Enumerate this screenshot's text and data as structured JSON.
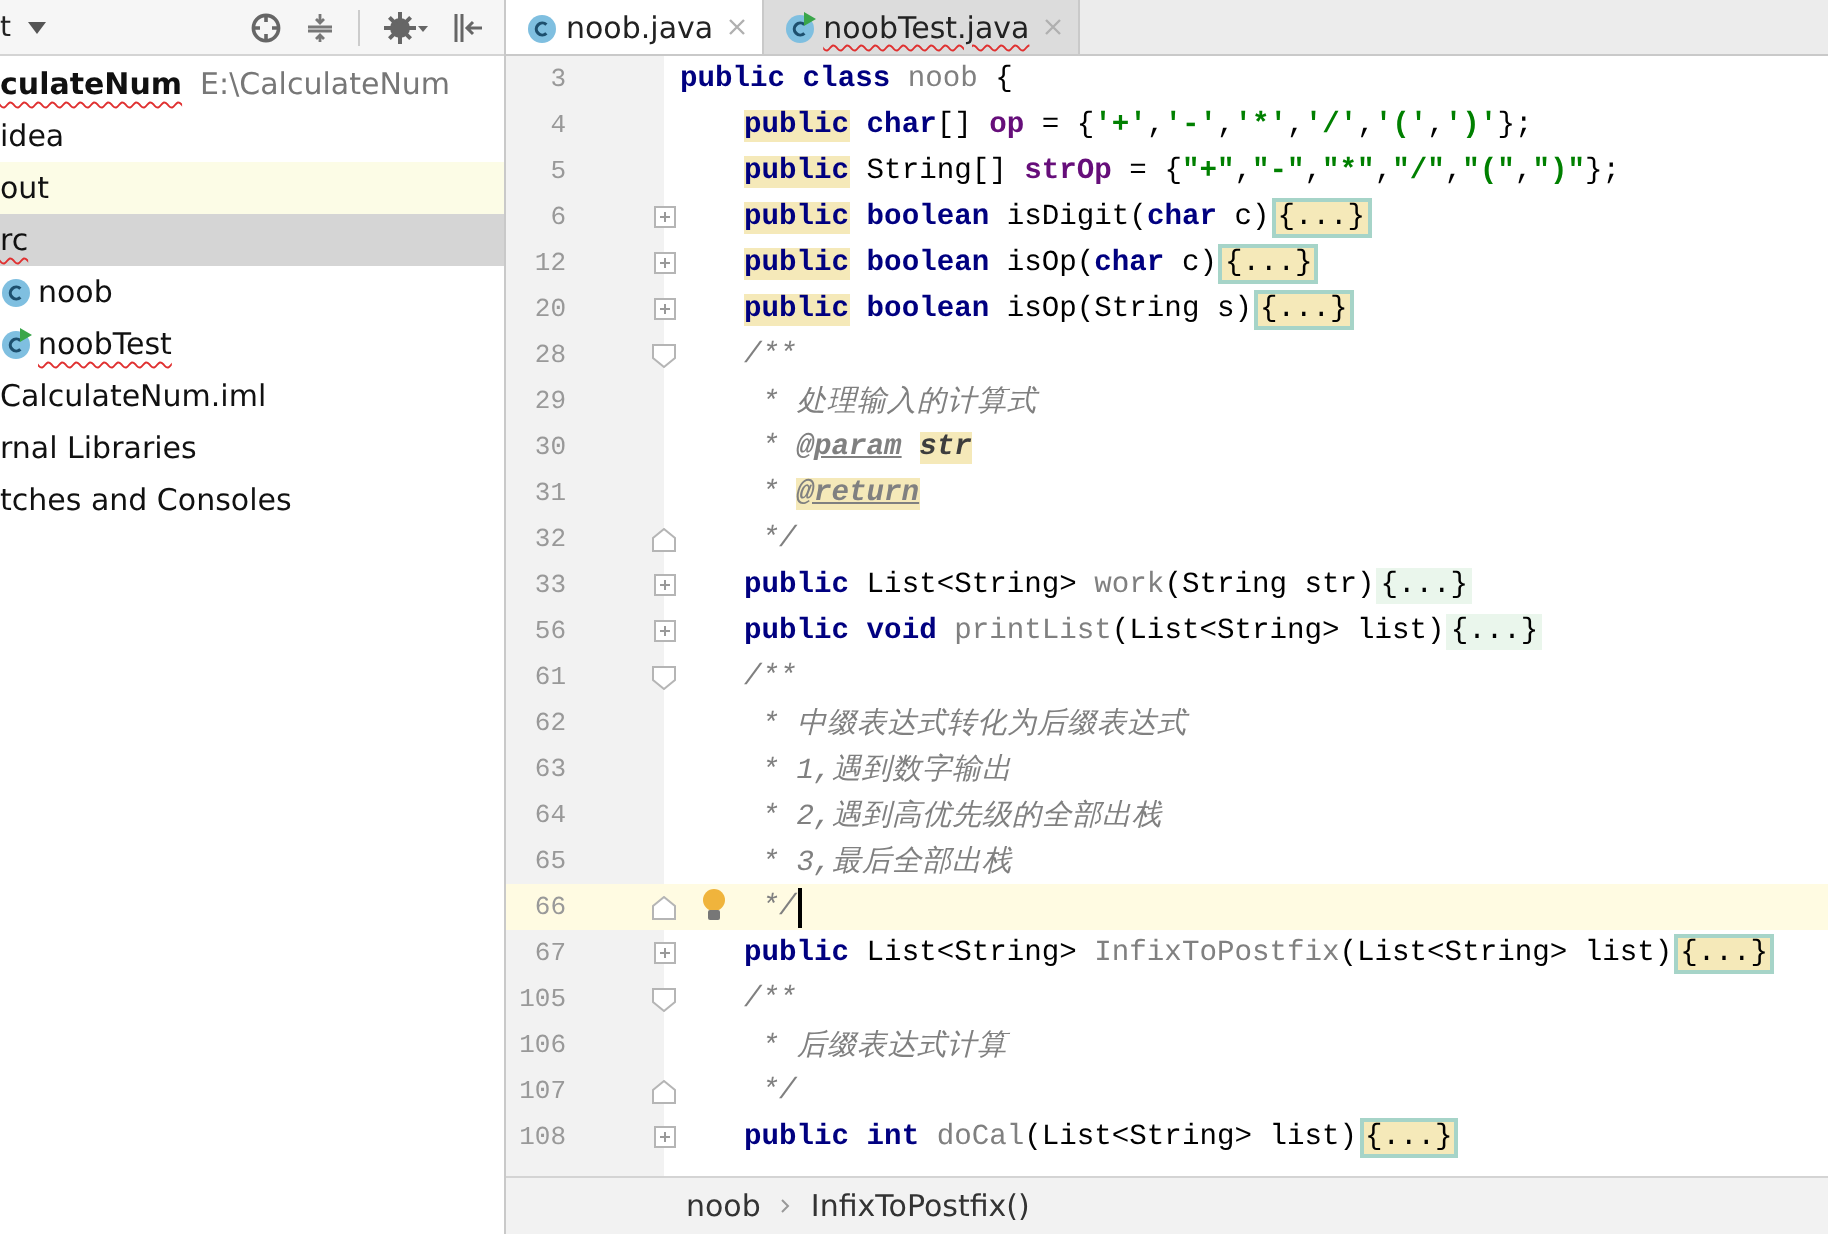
{
  "project_panel": {
    "view_selector": "t",
    "tree": [
      {
        "label": "culateNum",
        "note": "E:\\CalculateNum",
        "kind": "module",
        "typo": true,
        "selected": false,
        "highlighted": false,
        "children": [
          {
            "label": "idea",
            "typo": false,
            "selected": false,
            "highlighted": false
          },
          {
            "label": "out",
            "typo": false,
            "selected": false,
            "highlighted": true
          },
          {
            "label": "rc",
            "typo": true,
            "selected": true,
            "highlighted": false,
            "children": [
              {
                "label": "noob",
                "kind": "class",
                "typo": false,
                "selected": false,
                "highlighted": false
              },
              {
                "label": "noobTest",
                "kind": "test_class",
                "typo": true,
                "selected": false,
                "highlighted": false
              }
            ]
          },
          {
            "label": "CalculateNum.iml",
            "typo": false,
            "selected": false,
            "highlighted": false
          }
        ]
      },
      {
        "label": "rnal Libraries",
        "typo": false,
        "selected": false,
        "highlighted": false
      },
      {
        "label": "tches and Consoles",
        "typo": false,
        "selected": false,
        "highlighted": false
      }
    ]
  },
  "tabs": [
    {
      "label": "noob.java",
      "kind": "class",
      "typo": false,
      "selected": true
    },
    {
      "label": "noobTest.java",
      "kind": "test_class",
      "typo": true,
      "selected": false
    }
  ],
  "editor": {
    "lines": [
      {
        "number": "3",
        "indented": false,
        "current": false,
        "tokens": [
          {
            "text": "public class ",
            "kind": "kw"
          },
          {
            "text": "noob",
            "kind": "unused"
          },
          {
            "text": " {",
            "kind": "plain"
          }
        ]
      },
      {
        "number": "4",
        "indented": true,
        "current": false,
        "tokens": [
          {
            "text": "public",
            "kind": "kw_marked"
          },
          {
            "text": " char",
            "kind": "kw"
          },
          {
            "text": "[] ",
            "kind": "plain"
          },
          {
            "text": "op",
            "kind": "field"
          },
          {
            "text": " = {",
            "kind": "plain"
          },
          {
            "text": "'+'",
            "kind": "str"
          },
          {
            "text": ",",
            "kind": "plain"
          },
          {
            "text": "'-'",
            "kind": "str"
          },
          {
            "text": ",",
            "kind": "plain"
          },
          {
            "text": "'*'",
            "kind": "str"
          },
          {
            "text": ",",
            "kind": "plain"
          },
          {
            "text": "'/'",
            "kind": "str"
          },
          {
            "text": ",",
            "kind": "plain"
          },
          {
            "text": "'('",
            "kind": "str"
          },
          {
            "text": ",",
            "kind": "plain"
          },
          {
            "text": "')'",
            "kind": "str"
          },
          {
            "text": "};",
            "kind": "plain"
          }
        ]
      },
      {
        "number": "5",
        "indented": true,
        "current": false,
        "tokens": [
          {
            "text": "public",
            "kind": "kw_marked"
          },
          {
            "text": " String[] ",
            "kind": "plain"
          },
          {
            "text": "strOp",
            "kind": "field"
          },
          {
            "text": " = {",
            "kind": "plain"
          },
          {
            "text": "\"+\"",
            "kind": "str"
          },
          {
            "text": ",",
            "kind": "plain"
          },
          {
            "text": "\"-\"",
            "kind": "str"
          },
          {
            "text": ",",
            "kind": "plain"
          },
          {
            "text": "\"*\"",
            "kind": "str"
          },
          {
            "text": ",",
            "kind": "plain"
          },
          {
            "text": "\"/\"",
            "kind": "str"
          },
          {
            "text": ",",
            "kind": "plain"
          },
          {
            "text": "\"(\"",
            "kind": "str"
          },
          {
            "text": ",",
            "kind": "plain"
          },
          {
            "text": "\")\"",
            "kind": "str"
          },
          {
            "text": "};",
            "kind": "plain"
          }
        ]
      },
      {
        "number": "6",
        "fold": {
          "kind": "plus"
        },
        "indented": true,
        "current": false,
        "folded": {
          "text": "{...}",
          "marked": true
        },
        "tokens": [
          {
            "text": "public",
            "kind": "kw_marked"
          },
          {
            "text": " boolean",
            "kind": "kw"
          },
          {
            "text": " isDigit(",
            "kind": "plain"
          },
          {
            "text": "char",
            "kind": "kw"
          },
          {
            "text": " c)",
            "kind": "plain"
          }
        ]
      },
      {
        "number": "12",
        "fold": {
          "kind": "plus"
        },
        "indented": true,
        "current": false,
        "folded": {
          "text": "{...}",
          "marked": true
        },
        "tokens": [
          {
            "text": "public",
            "kind": "kw_marked"
          },
          {
            "text": " boolean",
            "kind": "kw"
          },
          {
            "text": " isOp(",
            "kind": "plain"
          },
          {
            "text": "char",
            "kind": "kw"
          },
          {
            "text": " c)",
            "kind": "plain"
          }
        ]
      },
      {
        "number": "20",
        "fold": {
          "kind": "plus"
        },
        "indented": true,
        "current": false,
        "folded": {
          "text": "{...}",
          "marked": true
        },
        "tokens": [
          {
            "text": "public",
            "kind": "kw_marked"
          },
          {
            "text": " boolean",
            "kind": "kw"
          },
          {
            "text": " isOp(String s)",
            "kind": "plain"
          }
        ]
      },
      {
        "number": "28",
        "fold": {
          "kind": "start"
        },
        "indented": true,
        "current": false,
        "tokens": [
          {
            "text": "/**",
            "kind": "comment"
          }
        ]
      },
      {
        "number": "29",
        "indented": true,
        "current": false,
        "tokens": [
          {
            "text": "* 处理输入的计算式",
            "kind": "doc_body"
          }
        ]
      },
      {
        "number": "30",
        "indented": true,
        "current": false,
        "tokens": [
          {
            "text": "* ",
            "kind": "doc_body"
          },
          {
            "text": "@param",
            "kind": "doctag"
          },
          {
            "text": "str",
            "kind": "param_marked"
          }
        ]
      },
      {
        "number": "31",
        "indented": true,
        "current": false,
        "tokens": [
          {
            "text": "* ",
            "kind": "doc_body"
          },
          {
            "text": "@return",
            "kind": "doctag_marked"
          }
        ]
      },
      {
        "number": "32",
        "fold": {
          "kind": "end"
        },
        "indented": true,
        "current": false,
        "tokens": [
          {
            "text": "*/",
            "kind": "doc_body"
          }
        ]
      },
      {
        "number": "33",
        "fold": {
          "kind": "plus"
        },
        "indented": true,
        "current": false,
        "folded": {
          "text": "{...}",
          "marked": false
        },
        "tokens": [
          {
            "text": "public",
            "kind": "kw"
          },
          {
            "text": " List<String> ",
            "kind": "plain"
          },
          {
            "text": "work",
            "kind": "unused"
          },
          {
            "text": "(String str)",
            "kind": "plain"
          }
        ]
      },
      {
        "number": "56",
        "fold": {
          "kind": "plus"
        },
        "indented": true,
        "current": false,
        "folded": {
          "text": "{...}",
          "marked": false
        },
        "tokens": [
          {
            "text": "public void",
            "kind": "kw"
          },
          {
            "text": " printList",
            "kind": "unused"
          },
          {
            "text": "(List<String> list)",
            "kind": "plain"
          }
        ]
      },
      {
        "number": "61",
        "fold": {
          "kind": "start"
        },
        "indented": true,
        "current": false,
        "tokens": [
          {
            "text": "/**",
            "kind": "comment"
          }
        ]
      },
      {
        "number": "62",
        "indented": true,
        "current": false,
        "tokens": [
          {
            "text": "* 中缀表达式转化为后缀表达式",
            "kind": "doc_body"
          }
        ]
      },
      {
        "number": "63",
        "indented": true,
        "current": false,
        "tokens": [
          {
            "text": "* 1,遇到数字输出",
            "kind": "doc_body"
          }
        ]
      },
      {
        "number": "64",
        "indented": true,
        "current": false,
        "tokens": [
          {
            "text": "* 2,遇到高优先级的全部出栈",
            "kind": "doc_body"
          }
        ]
      },
      {
        "number": "65",
        "indented": true,
        "current": false,
        "tokens": [
          {
            "text": "* 3,最后全部出栈",
            "kind": "doc_body"
          }
        ]
      },
      {
        "number": "66",
        "fold": {
          "kind": "end"
        },
        "indented": true,
        "current": true,
        "bulb": true,
        "caret": true,
        "tokens": [
          {
            "text": "*/",
            "kind": "doc_body"
          }
        ]
      },
      {
        "number": "67",
        "fold": {
          "kind": "plus"
        },
        "indented": true,
        "current": false,
        "folded": {
          "text": "{...}",
          "marked": true
        },
        "tokens": [
          {
            "text": "public",
            "kind": "kw"
          },
          {
            "text": " List<String> ",
            "kind": "plain"
          },
          {
            "text": "InfixToPostfix",
            "kind": "unused"
          },
          {
            "text": "(List<String> list)",
            "kind": "plain"
          }
        ]
      },
      {
        "number": "105",
        "fold": {
          "kind": "start"
        },
        "indented": true,
        "current": false,
        "tokens": [
          {
            "text": "/**",
            "kind": "comment"
          }
        ]
      },
      {
        "number": "106",
        "indented": true,
        "current": false,
        "tokens": [
          {
            "text": "* 后缀表达式计算",
            "kind": "doc_body"
          }
        ]
      },
      {
        "number": "107",
        "fold": {
          "kind": "end"
        },
        "indented": true,
        "current": false,
        "tokens": [
          {
            "text": "*/",
            "kind": "doc_body"
          }
        ]
      },
      {
        "number": "108",
        "fold": {
          "kind": "plus"
        },
        "indented": true,
        "current": false,
        "folded": {
          "text": "{...}",
          "marked": true
        },
        "tokens": [
          {
            "text": "public int",
            "kind": "kw"
          },
          {
            "text": " doCal",
            "kind": "unused"
          },
          {
            "text": "(List<String> list)",
            "kind": "plain"
          }
        ]
      }
    ]
  },
  "breadcrumb": [
    "noob",
    "InfixToPostfix()"
  ]
}
